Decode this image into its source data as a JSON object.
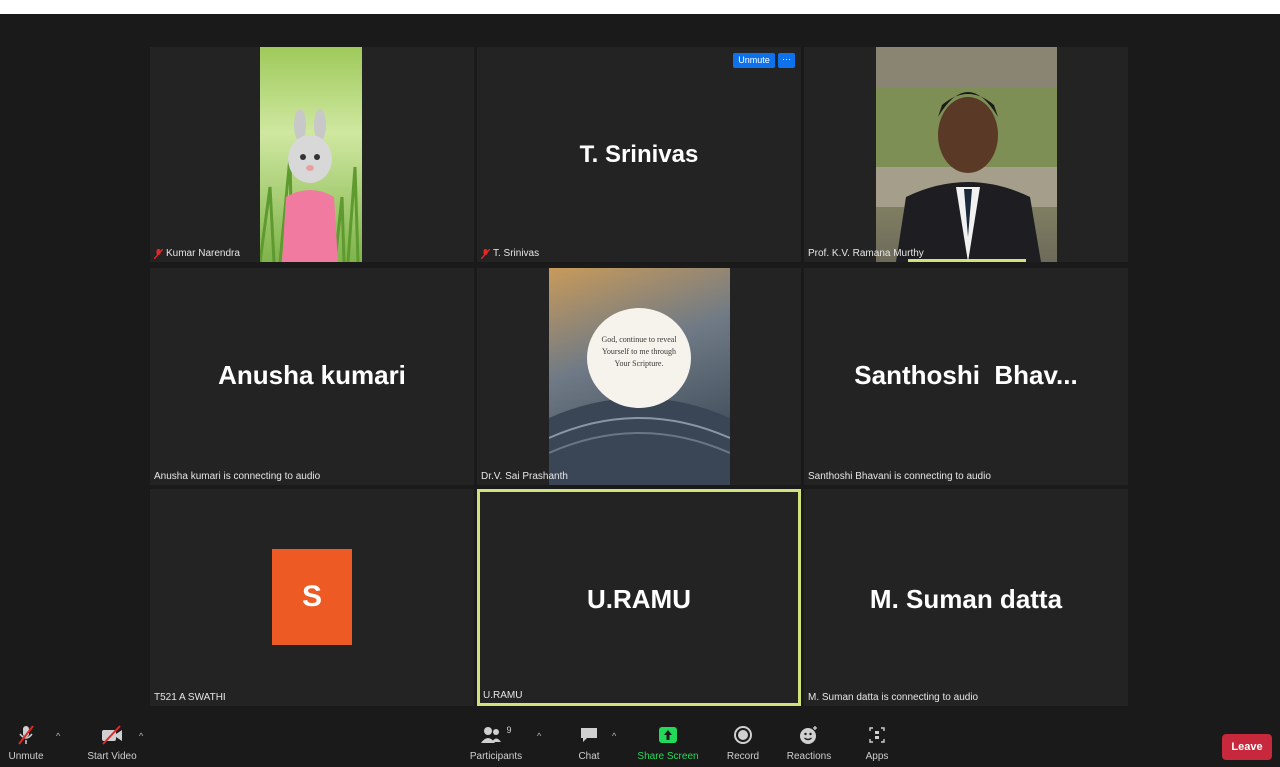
{
  "tiles": [
    {
      "id": "kumar",
      "name": "Kumar Narendra",
      "display": "",
      "status": ""
    },
    {
      "id": "srinivas",
      "name": "T. Srinivas",
      "display": "T. Srinivas",
      "status": ""
    },
    {
      "id": "ramana",
      "name": "Prof. K.V. Ramana Murthy",
      "display": "",
      "status": ""
    },
    {
      "id": "anusha",
      "name": "Anusha kumari",
      "display": "Anusha kumari",
      "status": "Anusha kumari is connecting to audio"
    },
    {
      "id": "sai",
      "name": "Dr.V. Sai Prashanth",
      "display": "",
      "status": ""
    },
    {
      "id": "santhoshi",
      "name": "Santhoshi Bhavani",
      "display": "Santhoshi  Bhav...",
      "status": "Santhoshi Bhavani is connecting to audio"
    },
    {
      "id": "swathi",
      "name": "T521 A SWATHI",
      "display": "S",
      "status": ""
    },
    {
      "id": "ramu",
      "name": "U.RAMU",
      "display": "U.RAMU",
      "status": ""
    },
    {
      "id": "suman",
      "name": "M. Suman datta",
      "display": "M. Suman datta",
      "status": "M. Suman datta is connecting to audio"
    }
  ],
  "tile_controls": {
    "unmute": "Unmute",
    "more": "···"
  },
  "scripture_text": "God, continue to reveal Yourself to me through Your Scripture.",
  "toolbar": {
    "unmute": "Unmute",
    "start_video": "Start Video",
    "participants": "Participants",
    "participants_count": "9",
    "chat": "Chat",
    "share_screen": "Share Screen",
    "record": "Record",
    "reactions": "Reactions",
    "apps": "Apps",
    "leave": "Leave"
  },
  "colors": {
    "accent_green": "#23d959",
    "leave_red": "#c8283b",
    "active_border": "#cfe27c",
    "avatar_orange": "#ee5a24",
    "unmute_blue": "#0e72ed"
  }
}
